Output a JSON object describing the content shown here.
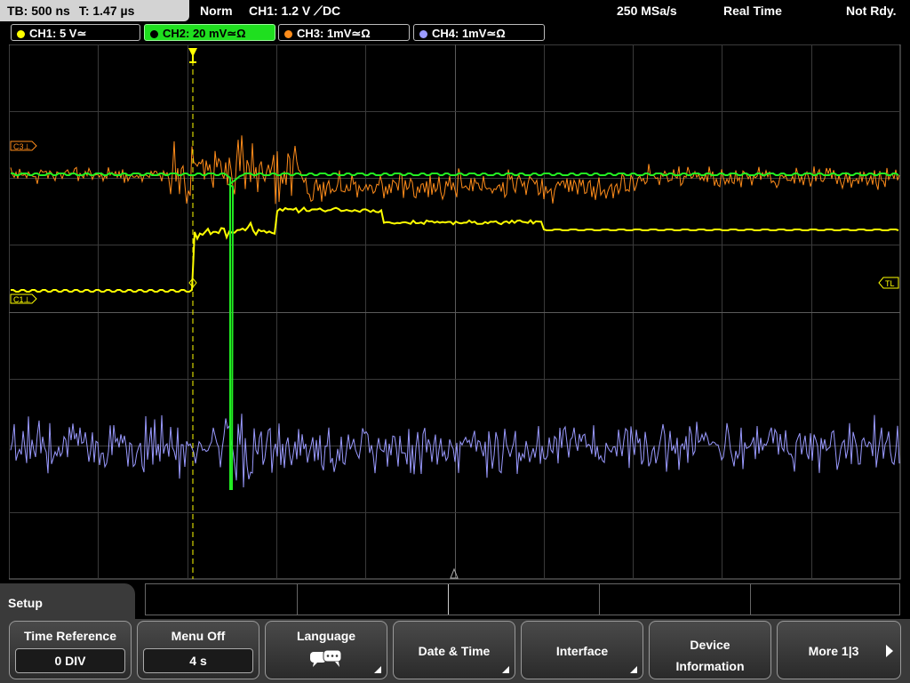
{
  "topbar": {
    "timebase": "TB: 500 ns",
    "trigger_time": "T: 1.47 µs",
    "mode": "Norm",
    "trigger": "CH1: 1.2 V ⟋DC",
    "sample_rate": "250 MSa/s",
    "acq_mode": "Real Time",
    "status": "Not Rdy."
  },
  "channels": [
    {
      "label": "CH1: 5 V≃",
      "color": "#ffff00"
    },
    {
      "label": "CH2: 20 mV≃Ω",
      "color": "#00ff00"
    },
    {
      "label": "CH3: 1mV≃Ω",
      "color": "#ff8c1a"
    },
    {
      "label": "CH4: 1mV≃Ω",
      "color": "#9a9aff"
    }
  ],
  "markers": {
    "c1": "C1⊥",
    "c3": "C3⊥",
    "tl": "TL"
  },
  "menu": {
    "title": "Setup",
    "softkeys": [
      {
        "label": "Time Reference",
        "value": "0 DIV"
      },
      {
        "label": "Menu Off",
        "value": "4 s"
      },
      {
        "label": "Language",
        "icon": "language-icon"
      },
      {
        "label": "Date & Time"
      },
      {
        "label": "Interface"
      },
      {
        "label_line1": "Device",
        "label_line2": "Information"
      },
      {
        "label": "More 1|3"
      }
    ]
  }
}
